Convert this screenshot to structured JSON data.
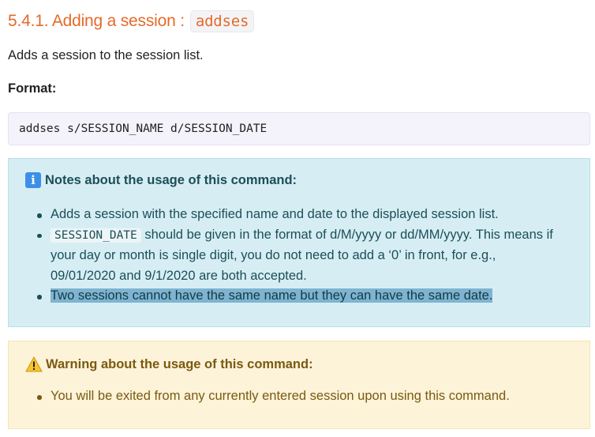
{
  "heading": {
    "text": "5.4.1. Adding a session :",
    "code": "addses"
  },
  "intro": "Adds a session to the session list.",
  "format": {
    "label": "Format:",
    "code": "addses s/SESSION_NAME d/SESSION_DATE"
  },
  "notes": {
    "icon": "info-icon",
    "title": "Notes about the usage of this command:",
    "items": {
      "item1": "Adds a session with the specified name and date to the displayed session list.",
      "item2_code": "SESSION_DATE",
      "item2_text": "should be given in the format of d/M/yyyy or dd/MM/yyyy. This means if your day or month is single digit, you do not need to add a ‘0’ in front, for e.g., 09/01/2020 and 9/1/2020 are both accepted.",
      "item3": "Two sessions cannot have the same name but they can have the same date."
    }
  },
  "warning": {
    "icon": "warning-icon",
    "title": "Warning about the usage of this command:",
    "item1": "You will be exited from any currently entered session upon using this command."
  },
  "colors": {
    "heading": "#e46a2a",
    "note_bg": "#d6eef3",
    "warning_bg": "#fdf3d8",
    "selection": "#7eb4d1"
  }
}
